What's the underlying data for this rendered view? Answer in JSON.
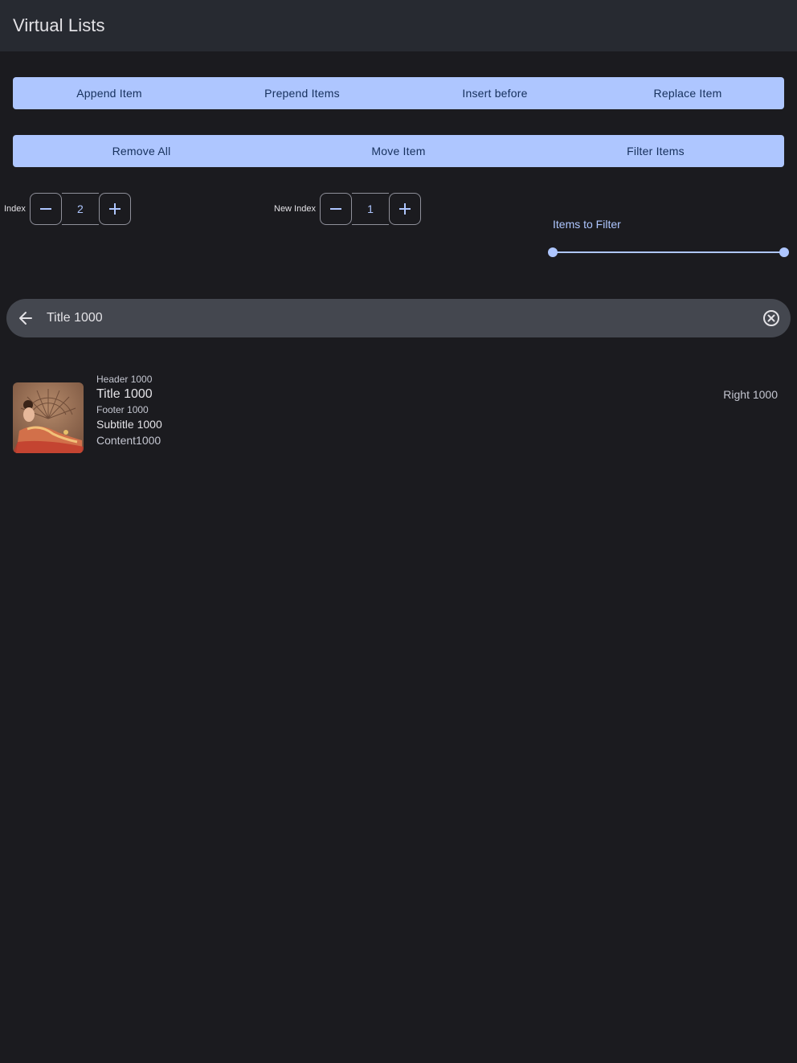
{
  "appbar": {
    "title": "Virtual Lists"
  },
  "actions_row1": [
    {
      "label": "Append Item"
    },
    {
      "label": "Prepend Items"
    },
    {
      "label": "Insert before"
    },
    {
      "label": "Replace Item"
    }
  ],
  "actions_row2": [
    {
      "label": "Remove All"
    },
    {
      "label": "Move Item"
    },
    {
      "label": "Filter Items"
    }
  ],
  "index_stepper": {
    "label": "Index",
    "value": "2"
  },
  "new_index_stepper": {
    "label": "New Index",
    "value": "1"
  },
  "filter": {
    "label": "Items to Filter",
    "range": [
      0,
      1
    ]
  },
  "search": {
    "query": "Title 1000",
    "icons": [
      "arrow-back-icon",
      "clear-icon"
    ]
  },
  "list": {
    "items": [
      {
        "header": "Header 1000",
        "title": "Title 1000",
        "footer": "Footer 1000",
        "subtitle": "Subtitle 1000",
        "content": "Content1000",
        "right": "Right 1000"
      }
    ]
  },
  "colors": {
    "accent": "#aec6ff",
    "background": "#1b1b1f",
    "appbar": "#272a31",
    "search": "#44474f"
  }
}
